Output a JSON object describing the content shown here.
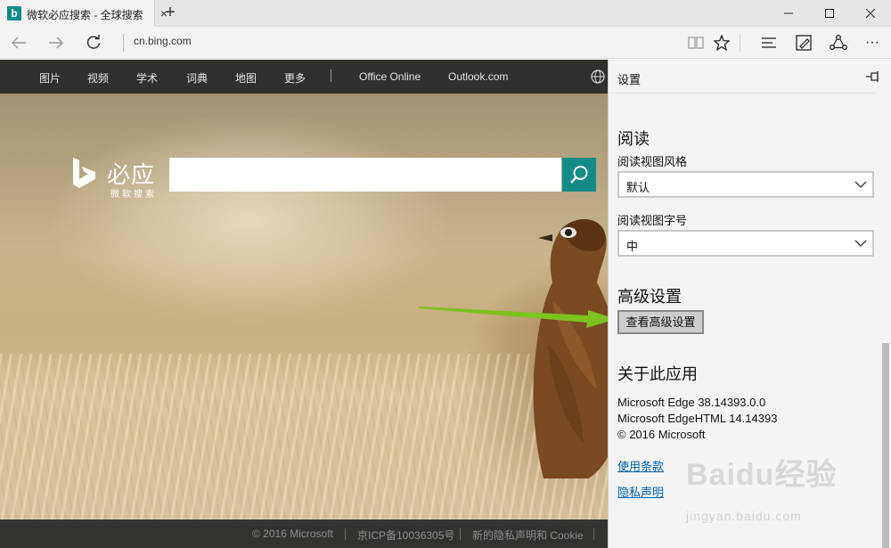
{
  "window": {
    "tab_title": "微软必应搜索 - 全球搜索",
    "tab_favicon": "b",
    "close_tab_glyph": "×",
    "new_tab_glyph": "+"
  },
  "toolbar": {
    "address": "cn.bing.com",
    "more_glyph": "···"
  },
  "bing": {
    "nav": [
      "图片",
      "视频",
      "学术",
      "词典",
      "地图",
      "更多",
      "Office Online",
      "Outlook.com"
    ],
    "logo_text": "必应",
    "logo_sub": "微软搜索",
    "search_placeholder": "",
    "footer": [
      "© 2016 Microsoft",
      "京ICP备10036305号",
      "新的隐私声明和 Cookie"
    ]
  },
  "settings": {
    "title": "设置",
    "reading_title": "阅读",
    "reading_style_label": "阅读视图风格",
    "reading_style_value": "默认",
    "reading_font_label": "阅读视图字号",
    "reading_font_value": "中",
    "advanced_title": "高级设置",
    "advanced_button": "查看高级设置",
    "about_title": "关于此应用",
    "about_lines": [
      "Microsoft Edge 38.14393.0.0",
      "Microsoft EdgeHTML 14.14393",
      "© 2016 Microsoft"
    ],
    "terms_link": "使用条款",
    "privacy_link": "隐私声明"
  },
  "watermark": {
    "text": "Baidu经验",
    "url": "jingyan.baidu.com"
  },
  "colors": {
    "bing_teal": "#138b8a",
    "link_blue": "#0063b1",
    "arrow_green": "#7dc21e"
  }
}
